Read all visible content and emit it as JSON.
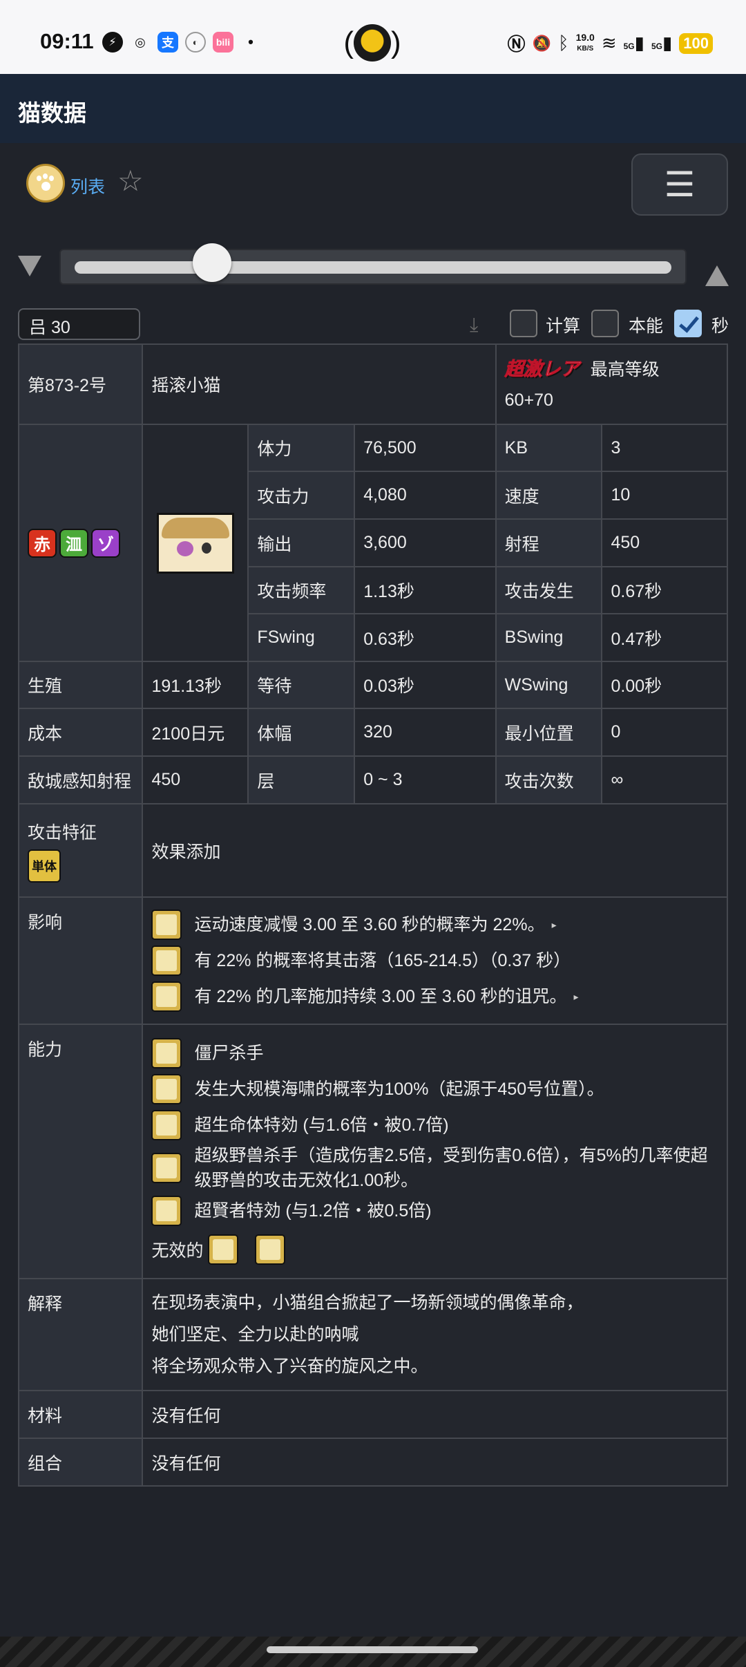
{
  "status_bar": {
    "time": "09:11",
    "net_speed_value": "19.0",
    "net_speed_unit": "KB/S",
    "battery": "100",
    "signal_label": "5G",
    "notification_icons": [
      "messenger-icon",
      "weibo-icon",
      "alipay-icon",
      "app-icon",
      "bilibili-icon",
      "dot-icon"
    ],
    "system_icons": [
      "nfc-icon",
      "mute-icon",
      "bluetooth-icon",
      "wifi-icon",
      "signal-icon",
      "signal-icon"
    ]
  },
  "header": {
    "title": "猫数据"
  },
  "nav": {
    "list_label": "列表",
    "star_glyph": "☆",
    "menu_glyph": "☰"
  },
  "level_input": {
    "value": "吕 30"
  },
  "options": {
    "calc_label": "计算",
    "talent_label": "本能",
    "seconds_label": "秒",
    "calc_checked": false,
    "talent_checked": false,
    "seconds_checked": true
  },
  "slider": {
    "level_fraction": 0.23
  },
  "unit": {
    "id": "第873-2号",
    "name": "摇滚小猫",
    "rarity": "超激レア",
    "max_level_label": "最高等级",
    "max_level": "60+70"
  },
  "traits": [
    {
      "glyph": "赤",
      "color": "#d8321e"
    },
    {
      "glyph": "㳑",
      "color": "#4caa3a"
    },
    {
      "glyph": "ゾ",
      "color": "#9a40c8"
    }
  ],
  "stats": {
    "hp_label": "体力",
    "hp": "76,500",
    "kb_label": "KB",
    "kb": "3",
    "atk_label": "攻击力",
    "atk": "4,080",
    "speed_label": "速度",
    "speed": "10",
    "dps_label": "输出",
    "dps": "3,600",
    "range_label": "射程",
    "range": "450",
    "freq_label": "攻击频率",
    "freq": "1.13秒",
    "foreswing_label": "攻击发生",
    "foreswing": "0.67秒",
    "fswing_label": "FSwing",
    "fswing": "0.63秒",
    "bswing_label": "BSwing",
    "bswing": "0.47秒",
    "respawn_label": "生殖",
    "respawn": "191.13秒",
    "wait_label": "等待",
    "wait": "0.03秒",
    "wswing_label": "WSwing",
    "wswing": "0.00秒",
    "cost_label": "成本",
    "cost": "2100日元",
    "width_label": "体幅",
    "width": "320",
    "minpos_label": "最小位置",
    "minpos": "0",
    "trigger_label": "敌城感知射程",
    "trigger": "450",
    "layer_label": "层",
    "layer": "0 ~ 3",
    "hits_label": "攻击次数",
    "hits": "∞"
  },
  "attack_type": {
    "label": "攻击特征",
    "tag": "単体",
    "value": "效果添加"
  },
  "effects": {
    "label": "影响",
    "items": [
      {
        "icon": "slow-icon",
        "text": "运动速度减慢 3.00 至 3.60 秒的概率为 22%。",
        "arrow": "▸"
      },
      {
        "icon": "knockback-icon",
        "text": "有 22% 的概率将其击落（165-214.5）（0.37 秒）",
        "arrow": ""
      },
      {
        "icon": "curse-icon",
        "text": "有 22% 的几率施加持续 3.00 至 3.60 秒的诅咒。",
        "arrow": "▸"
      }
    ]
  },
  "abilities": {
    "label": "能力",
    "items": [
      {
        "icon": "zombie-killer-icon",
        "text": "僵尸杀手"
      },
      {
        "icon": "surge-icon",
        "text": "发生大规模海啸的概率为100%（起源于450号位置）。"
      },
      {
        "icon": "behemoth-icon",
        "text": "超生命体特効 (与1.6倍・被0.7倍)"
      },
      {
        "icon": "colossus-slayer-icon",
        "text": "超级野兽杀手（造成伤害2.5倍，受到伤害0.6倍），有5%的几率使超级野兽的攻击无效化1.00秒。"
      },
      {
        "icon": "sage-slayer-icon",
        "text": "超賢者特効 (与1.2倍・被0.5倍)"
      }
    ],
    "immune_label": "无效的",
    "immune_icons": [
      "no-slow-icon",
      "no-curse-icon"
    ]
  },
  "description": {
    "label": "解释",
    "lines": [
      "在现场表演中，小猫组合掀起了一场新领域的偶像革命，",
      "她们坚定、全力以赴的呐喊",
      "将全场观众带入了兴奋的旋风之中。"
    ]
  },
  "materials": {
    "label": "材料",
    "value": "没有任何"
  },
  "combo": {
    "label": "组合",
    "value": "没有任何"
  }
}
